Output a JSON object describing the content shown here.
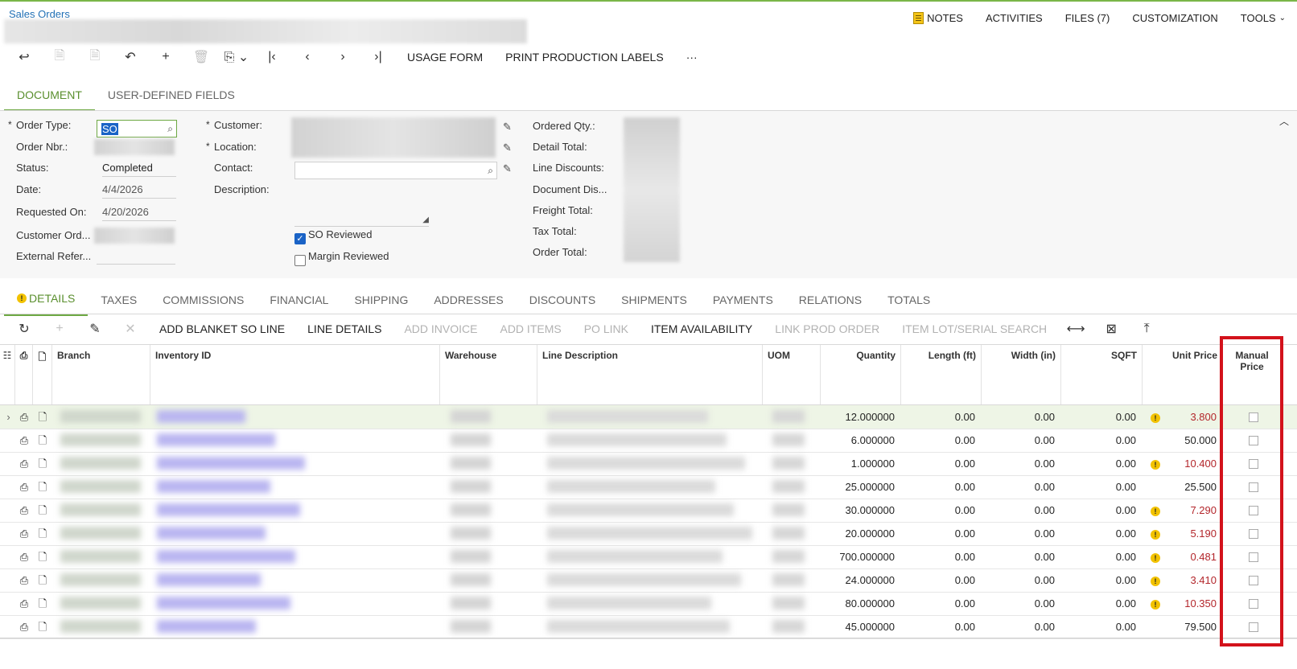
{
  "header": {
    "breadcrumb": "Sales Orders",
    "menu": [
      "NOTES",
      "ACTIVITIES",
      "FILES (7)",
      "CUSTOMIZATION",
      "TOOLS"
    ]
  },
  "toolbar": {
    "usage_form": "USAGE FORM",
    "print_labels": "PRINT PRODUCTION LABELS",
    "more": "···"
  },
  "doc_tabs": [
    "DOCUMENT",
    "USER-DEFINED FIELDS"
  ],
  "form": {
    "order_type_label": "Order Type:",
    "order_type_value": "SO",
    "order_nbr_label": "Order Nbr.:",
    "status_label": "Status:",
    "status_value": "Completed",
    "date_label": "Date:",
    "date_value": "4/4/2026",
    "requested_label": "Requested On:",
    "requested_value": "4/20/2026",
    "customer_ord_label": "Customer Ord...",
    "external_ref_label": "External Refer...",
    "customer_label": "Customer:",
    "location_label": "Location:",
    "contact_label": "Contact:",
    "description_label": "Description:",
    "so_reviewed_label": "SO Reviewed",
    "so_reviewed": true,
    "margin_reviewed_label": "Margin Reviewed",
    "margin_reviewed": false,
    "ordered_qty_label": "Ordered Qty.:",
    "detail_total_label": "Detail Total:",
    "line_discounts_label": "Line Discounts:",
    "document_dis_label": "Document Dis...",
    "freight_total_label": "Freight Total:",
    "tax_total_label": "Tax Total:",
    "order_total_label": "Order Total:"
  },
  "detail_tabs": [
    "DETAILS",
    "TAXES",
    "COMMISSIONS",
    "FINANCIAL",
    "SHIPPING",
    "ADDRESSES",
    "DISCOUNTS",
    "SHIPMENTS",
    "PAYMENTS",
    "RELATIONS",
    "TOTALS"
  ],
  "grid_toolbar": {
    "add_blanket": "ADD BLANKET SO LINE",
    "line_details": "LINE DETAILS",
    "add_invoice": "ADD INVOICE",
    "add_items": "ADD ITEMS",
    "po_link": "PO LINK",
    "item_availability": "ITEM AVAILABILITY",
    "link_prod_order": "LINK PROD ORDER",
    "lot_serial_search": "ITEM LOT/SERIAL SEARCH"
  },
  "grid": {
    "columns": {
      "branch": "Branch",
      "inventory_id": "Inventory ID",
      "warehouse": "Warehouse",
      "line_description": "Line Description",
      "uom": "UOM",
      "quantity": "Quantity",
      "length": "Length (ft)",
      "width": "Width (in)",
      "sqft": "SQFT",
      "unit_price": "Unit Price",
      "manual_price": "Manual Price"
    },
    "rows": [
      {
        "quantity": "12.000000",
        "length": "0.00",
        "width": "0.00",
        "sqft": "0.00",
        "warn": true,
        "unit_price": "3.800",
        "red": true
      },
      {
        "quantity": "6.000000",
        "length": "0.00",
        "width": "0.00",
        "sqft": "0.00",
        "warn": false,
        "unit_price": "50.000",
        "red": false
      },
      {
        "quantity": "1.000000",
        "length": "0.00",
        "width": "0.00",
        "sqft": "0.00",
        "warn": true,
        "unit_price": "10.400",
        "red": true
      },
      {
        "quantity": "25.000000",
        "length": "0.00",
        "width": "0.00",
        "sqft": "0.00",
        "warn": false,
        "unit_price": "25.500",
        "red": false
      },
      {
        "quantity": "30.000000",
        "length": "0.00",
        "width": "0.00",
        "sqft": "0.00",
        "warn": true,
        "unit_price": "7.290",
        "red": true
      },
      {
        "quantity": "20.000000",
        "length": "0.00",
        "width": "0.00",
        "sqft": "0.00",
        "warn": true,
        "unit_price": "5.190",
        "red": true
      },
      {
        "quantity": "700.000000",
        "length": "0.00",
        "width": "0.00",
        "sqft": "0.00",
        "warn": true,
        "unit_price": "0.481",
        "red": true
      },
      {
        "quantity": "24.000000",
        "length": "0.00",
        "width": "0.00",
        "sqft": "0.00",
        "warn": true,
        "unit_price": "3.410",
        "red": true
      },
      {
        "quantity": "80.000000",
        "length": "0.00",
        "width": "0.00",
        "sqft": "0.00",
        "warn": true,
        "unit_price": "10.350",
        "red": true
      },
      {
        "quantity": "45.000000",
        "length": "0.00",
        "width": "0.00",
        "sqft": "0.00",
        "warn": false,
        "unit_price": "79.500",
        "red": false
      }
    ]
  },
  "colors": {
    "accent": "#6ea843",
    "link": "#1f6fb5",
    "warn": "#f2c200",
    "price_red": "#b3262b",
    "highlight": "#d3121b"
  }
}
